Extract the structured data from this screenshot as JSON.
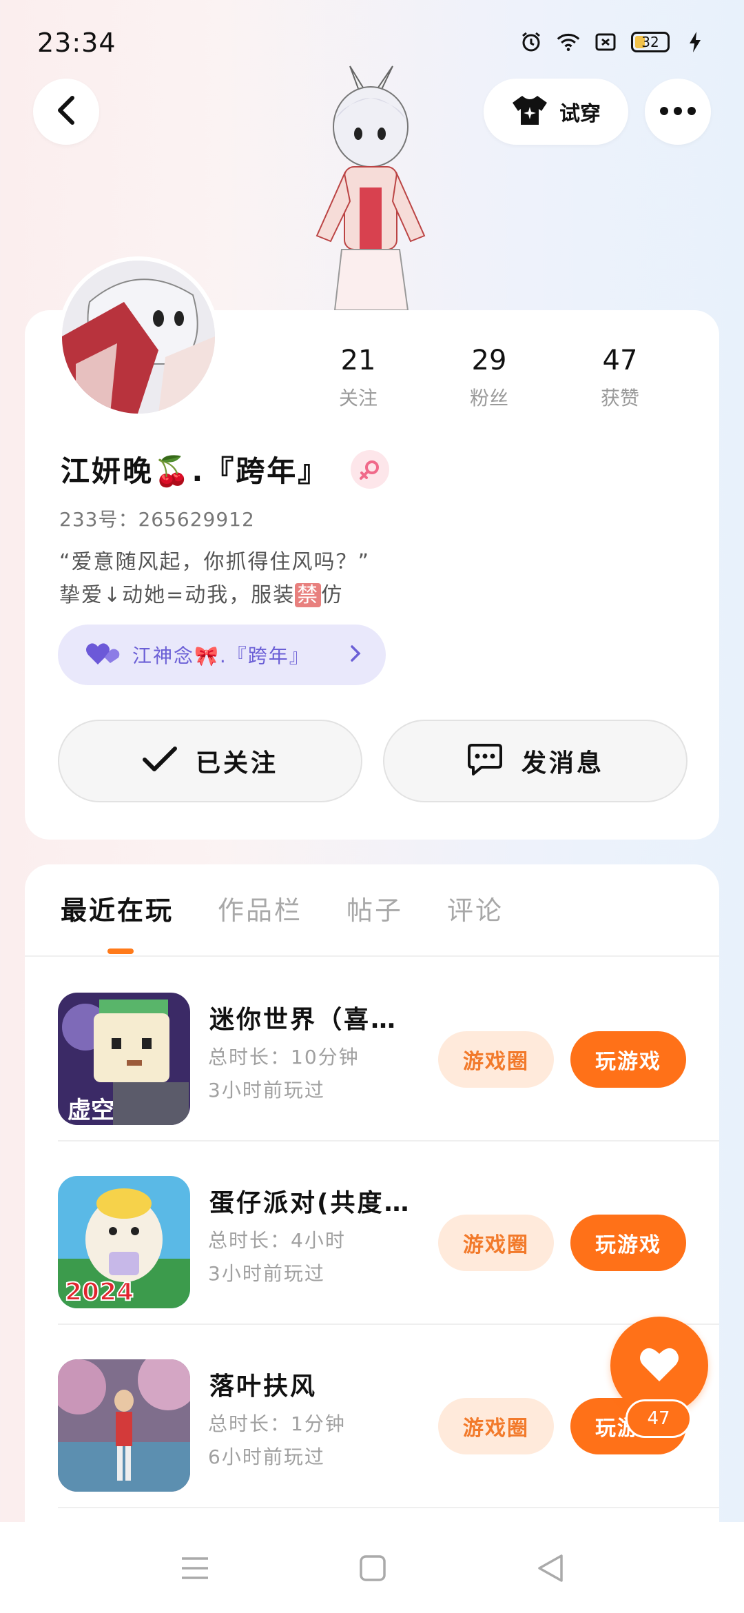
{
  "status_bar": {
    "time": "23:34",
    "battery": "32",
    "icons": [
      "alarm-icon",
      "wifi-icon",
      "sim-icon",
      "battery-icon",
      "charging-icon"
    ]
  },
  "header": {
    "tryon_label": "试穿",
    "icons": [
      "back-icon",
      "tshirt-icon",
      "more-icon"
    ]
  },
  "profile": {
    "stats": [
      {
        "value": "21",
        "label": "关注"
      },
      {
        "value": "29",
        "label": "粉丝"
      },
      {
        "value": "47",
        "label": "获赞"
      }
    ],
    "name_part1": "江妍晚",
    "name_emoji": "🍒",
    "name_part2": ".『跨年』",
    "uid": "233号：265629912",
    "bio_line1": "“爱意随风起，你抓得住风吗？”",
    "bio_line2_prefix": "挚爱↓动她=动我，服装",
    "bio_line2_badge": "禁",
    "bio_line2_suffix": "仿",
    "cp_label": "江神念🎀.『跨年』",
    "follow_label": "已关注",
    "message_label": "发消息"
  },
  "tabs": [
    {
      "label": "最近在玩",
      "active": true
    },
    {
      "label": "作品栏",
      "active": false
    },
    {
      "label": "帖子",
      "active": false
    },
    {
      "label": "评论",
      "active": false
    }
  ],
  "games": [
    {
      "title": "迷你世界（喜…",
      "duration": "总时长：10分钟",
      "last_played": "3小时前玩过",
      "circle_label": "游戏圈",
      "play_label": "玩游戏",
      "thumb_text": "虚空"
    },
    {
      "title": "蛋仔派对(共度…",
      "duration": "总时长：4小时",
      "last_played": "3小时前玩过",
      "circle_label": "游戏圈",
      "play_label": "玩游戏",
      "thumb_text": "2024"
    },
    {
      "title": "落叶扶风",
      "duration": "总时长：1分钟",
      "last_played": "6小时前玩过",
      "circle_label": "游戏圈",
      "play_label": "玩游戏",
      "thumb_text": ""
    }
  ],
  "like_fab": {
    "count": "47"
  },
  "colors": {
    "accent": "#ff7118",
    "accent_soft": "#ffeadb",
    "cp_bg": "#e9e8fb",
    "cp_text": "#6b5fd6"
  }
}
